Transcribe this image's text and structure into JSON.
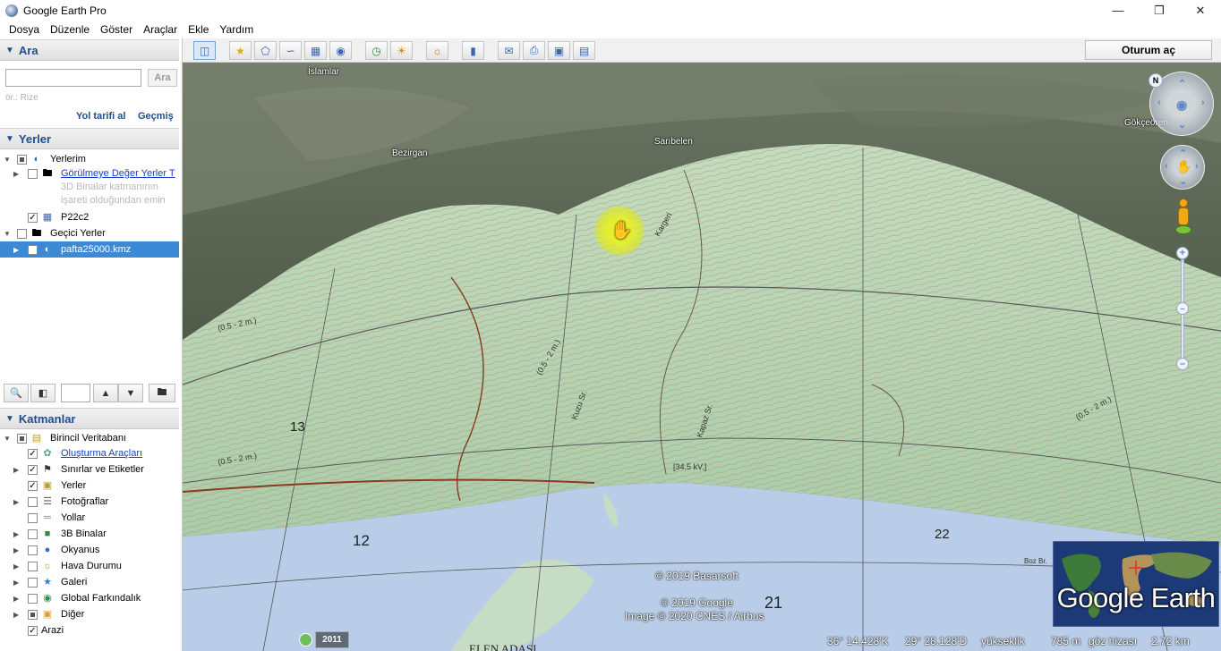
{
  "window": {
    "title": "Google Earth Pro",
    "minimize_icon": "minimize-icon",
    "maximize_icon": "maximize-icon",
    "close_icon": "close-icon"
  },
  "menu": [
    "Dosya",
    "Düzenle",
    "Göster",
    "Araçlar",
    "Ekle",
    "Yardım"
  ],
  "search": {
    "header": "Ara",
    "placeholder": "",
    "button": "Ara",
    "hint": "ör.: Rize",
    "directions_link": "Yol tarifi al",
    "history_link": "Geçmiş"
  },
  "places": {
    "header": "Yerler",
    "items": [
      {
        "label": "Yerlerim",
        "icon": "my-places-icon"
      },
      {
        "label": "Görülmeye Değer Yerler T",
        "icon": "folder-icon"
      },
      {
        "label": "P22c2",
        "icon": "overlay-icon"
      },
      {
        "label": "Geçici Yerler",
        "icon": "folder-icon"
      },
      {
        "label": "pafta25000.kmz",
        "icon": "kmz-icon"
      }
    ],
    "desc_line1": "3D Binalar katmanının",
    "desc_line2": "işareti olduğundan emin"
  },
  "layers": {
    "header": "Katmanlar",
    "items": [
      {
        "label": "Birincil Veritabanı"
      },
      {
        "label": "Oluşturma Araçları"
      },
      {
        "label": "Sınırlar ve Etiketler"
      },
      {
        "label": "Yerler"
      },
      {
        "label": "Fotoğraflar"
      },
      {
        "label": "Yollar"
      },
      {
        "label": "3B Binalar"
      },
      {
        "label": "Okyanus"
      },
      {
        "label": "Hava Durumu"
      },
      {
        "label": "Galeri"
      },
      {
        "label": "Global Farkındalık"
      },
      {
        "label": "Diğer"
      },
      {
        "label": "Arazi"
      }
    ]
  },
  "toolbar": {
    "signin": "Oturum aç"
  },
  "map": {
    "places": [
      "Bezirgan",
      "Sarıbelen",
      "Gökçeören",
      "İslamlar"
    ],
    "copyright_basarsoft": "© 2019 Basarsoft",
    "copyright_google": "© 2019 Google",
    "copyright_image": "Image © 2020 CNES / Airbus",
    "logo": "Google Earth",
    "compass_label": "N",
    "year": "2011",
    "status": {
      "lat": "36° 14.428'K",
      "lon": "29° 28.128'D",
      "elev_label": "yükseklik",
      "elev_value": "785 m",
      "eye_label": "göz hizası",
      "eye_value": "2.72 km"
    },
    "grid_numbers": [
      "13",
      "12",
      "21",
      "22"
    ],
    "map_labels": [
      "(0.5 - 2 m.)",
      "Kuzu Sr.",
      "Kapaz Sr.",
      "[34.5 kV.]",
      "Kargeri",
      "ELEN ADASI",
      "Bozburun"
    ]
  },
  "colors": {
    "header_text": "#1f4f8f",
    "selected_row": "#3c8ad6",
    "link": "#1a3cc8",
    "sea": "#b9cde8",
    "map_land": "#b8d4b2"
  }
}
